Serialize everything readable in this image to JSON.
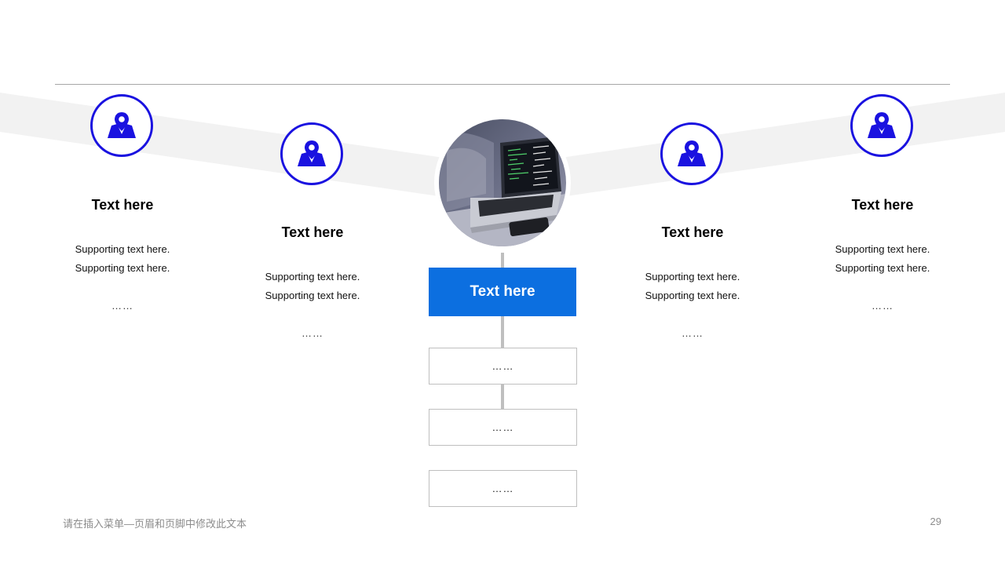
{
  "columns": [
    {
      "title": "Text here",
      "line1": "Supporting  text here.",
      "line2": "Supporting  text here.",
      "dots": "……"
    },
    {
      "title": "Text here",
      "line1": "Supporting  text here.",
      "line2": "Supporting  text here.",
      "dots": "……"
    },
    {
      "title": "Text here",
      "line1": "Supporting  text here.",
      "line2": "Supporting  text here.",
      "dots": "……"
    },
    {
      "title": "Text here",
      "line1": "Supporting  text here.",
      "line2": "Supporting  text here.",
      "dots": "……"
    }
  ],
  "center": {
    "title": "Text here",
    "boxes": [
      "……",
      "……",
      "……"
    ]
  },
  "footer": {
    "text": "请在插入菜单—页眉和页脚中修改此文本",
    "page": "29"
  },
  "colors": {
    "icon": "#1a12e0",
    "accent": "#0c6fe0",
    "band": "#f2f2f2"
  },
  "icons": {
    "column": "map-pin-icon",
    "center": "laptop-photo"
  }
}
